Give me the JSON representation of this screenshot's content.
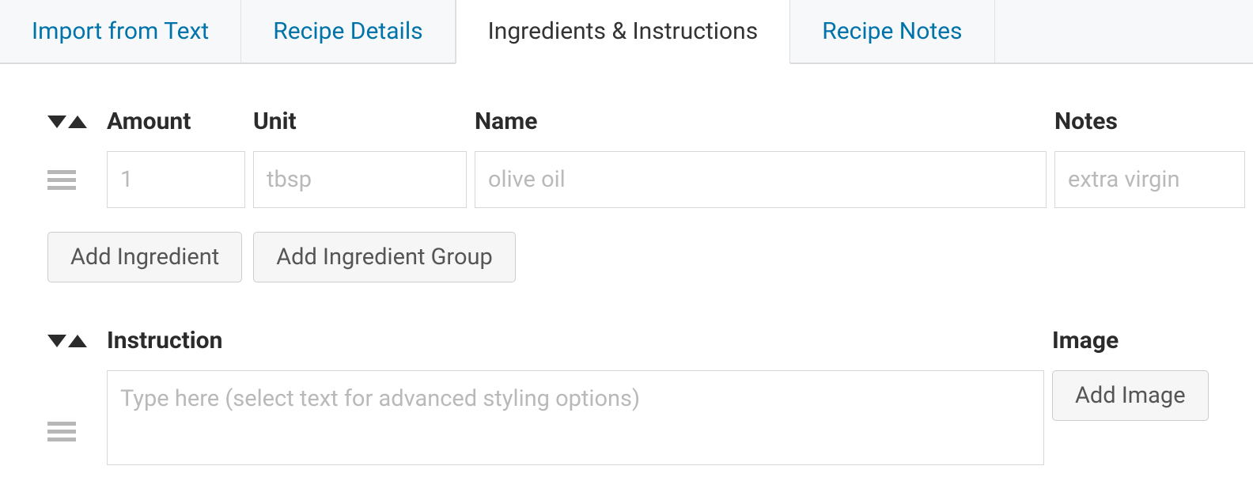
{
  "tabs": [
    {
      "label": "Import from Text",
      "active": false
    },
    {
      "label": "Recipe Details",
      "active": false
    },
    {
      "label": "Ingredients & Instructions",
      "active": true
    },
    {
      "label": "Recipe Notes",
      "active": false
    }
  ],
  "ingredients": {
    "headers": {
      "amount": "Amount",
      "unit": "Unit",
      "name": "Name",
      "notes": "Notes"
    },
    "row": {
      "amount_value": "",
      "amount_placeholder": "1",
      "unit_value": "",
      "unit_placeholder": "tbsp",
      "name_value": "",
      "name_placeholder": "olive oil",
      "notes_value": "",
      "notes_placeholder": "extra virgin"
    },
    "buttons": {
      "add_ingredient": "Add Ingredient",
      "add_group": "Add Ingredient Group"
    }
  },
  "instructions": {
    "headers": {
      "instruction": "Instruction",
      "image": "Image"
    },
    "row": {
      "text_value": "",
      "text_placeholder": "Type here (select text for advanced styling options)"
    },
    "buttons": {
      "add_image": "Add Image"
    }
  }
}
